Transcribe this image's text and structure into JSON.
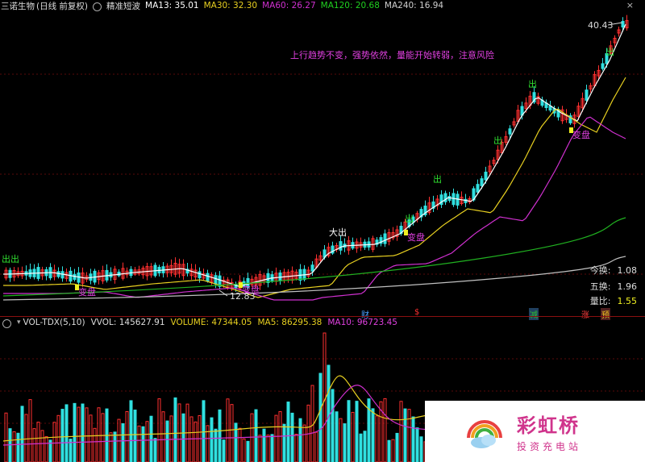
{
  "header": {
    "stock_name": "三诺生物",
    "period": "(日线 前复权)",
    "indicator_name": "精准短波",
    "ma13": "MA13: 35.01",
    "ma30": "MA30: 32.30",
    "ma60": "MA60: 26.27",
    "ma120": "MA120: 20.68",
    "ma240": "MA240: 16.94",
    "close_symbol": "×"
  },
  "colors": {
    "ma13": "#ffffff",
    "ma30": "#e8d020",
    "ma60": "#d030d0",
    "ma120": "#20b020",
    "ma240": "#c0c0c0",
    "up": "#ff3030",
    "down": "#30e0e0",
    "annotation": "#e040e0",
    "signal": "#f0f020"
  },
  "chart": {
    "high_label": "40.43",
    "low_label": "12.83",
    "comment": "上行趋势不变，强势依然，量能开始转弱，注意风险",
    "signals": [
      {
        "text": "出出",
        "kind": "out"
      },
      {
        "text": "变盘",
        "kind": "change"
      },
      {
        "text": "变盘",
        "kind": "change"
      },
      {
        "text": "大出",
        "kind": "bigout"
      },
      {
        "text": "出",
        "kind": "out"
      },
      {
        "text": "变盘",
        "kind": "change"
      },
      {
        "text": "出",
        "kind": "out"
      },
      {
        "text": "出",
        "kind": "out"
      },
      {
        "text": "出",
        "kind": "out"
      },
      {
        "text": "变盘",
        "kind": "change"
      },
      {
        "text": "出",
        "kind": "out"
      }
    ]
  },
  "stats": {
    "today_label": "今换:",
    "today_value": "1.08",
    "five_label": "五换:",
    "five_value": "1.96",
    "ratio_label": "量比:",
    "ratio_value": "1.55"
  },
  "flags": [
    {
      "text": "财",
      "color": "#4aa0ff"
    },
    {
      "text": "$",
      "color": "#ff3030"
    },
    {
      "text": "减",
      "color": "#30c030",
      "bg": "#204060"
    },
    {
      "text": "涨",
      "color": "#ff4040"
    },
    {
      "text": "预",
      "color": "#f0c020",
      "bg": "#502020"
    }
  ],
  "volume": {
    "indicator": "VOL-TDX(5,10)",
    "vvol": "VVOL: 145627.91",
    "volume": "VOLUME: 47344.05",
    "ma5": "MA5: 86295.38",
    "ma10": "MA10: 96723.45"
  },
  "watermark": {
    "title": "彩虹桥",
    "subtitle": "投资充电站"
  }
}
